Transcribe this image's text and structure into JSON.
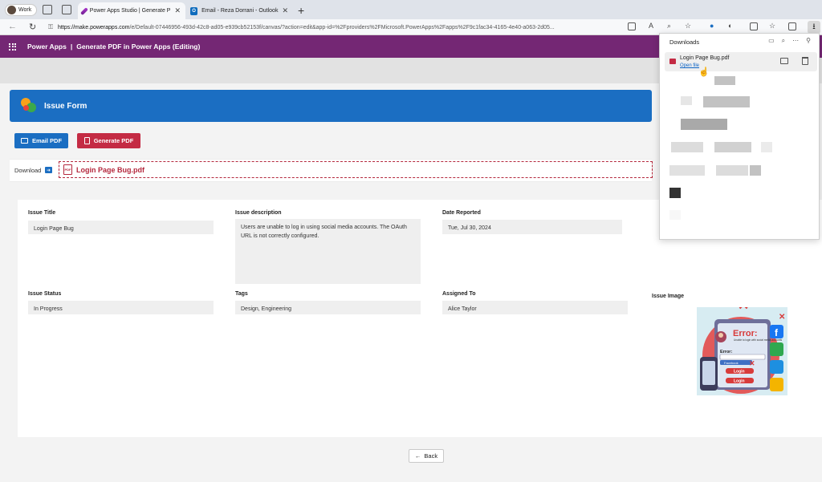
{
  "browser": {
    "profile_label": "Work",
    "tabs": [
      {
        "title": "Power Apps Studio | Generate P",
        "favicon": "power-apps-icon",
        "active": true
      },
      {
        "title": "Email - Reza Dorrani - Outlook",
        "favicon": "outlook-icon",
        "active": false
      }
    ],
    "url_host": "https://make.powerapps.com",
    "url_path": "/e/Default-07446956-493d-42c8-ad05-e939cb52153f/canvas/?action=edit&app-id=%2Fproviders%2FMicrosoft.PowerApps%2Fapps%2F9c1fac34-4165-4e40-a063-2d05..."
  },
  "app_header": {
    "product": "Power Apps",
    "separator": "|",
    "app_name": "Generate PDF in Power Apps (Editing)"
  },
  "form": {
    "title": "Issue Form",
    "email_pdf_label": "Email PDF",
    "generate_pdf_label": "Generate PDF",
    "download_label": "Download",
    "pdf_file_name": "Login Page Bug.pdf",
    "fields": {
      "issue_title": {
        "label": "Issue Title",
        "value": "Login Page Bug"
      },
      "issue_description": {
        "label": "Issue description",
        "value": "Users are unable to log in using social media accounts. The OAuth URL is not correctly configured."
      },
      "date_reported": {
        "label": "Date Reported",
        "value": "Tue, Jul 30, 2024"
      },
      "issue_status": {
        "label": "Issue Status",
        "value": "In Progress"
      },
      "tags": {
        "label": "Tags",
        "value": "Design, Engineering"
      },
      "assigned_to": {
        "label": "Assigned To",
        "value": "Alice Taylor"
      },
      "issue_image": {
        "label": "Issue Image"
      }
    },
    "back_label": "Back"
  },
  "issue_image_text": {
    "error_title": "Error:",
    "error_sub": "Unable to login with social media accounts",
    "field_label": "Error:",
    "facebook": "Facebook",
    "login1": "Login",
    "login2": "Login"
  },
  "downloads_panel": {
    "title": "Downloads",
    "file_name": "Login Page Bug.pdf",
    "open_file": "Open file"
  },
  "colors": {
    "brand_purple": "#742774",
    "form_blue": "#1b6ec2",
    "pdf_red": "#c42b44"
  }
}
